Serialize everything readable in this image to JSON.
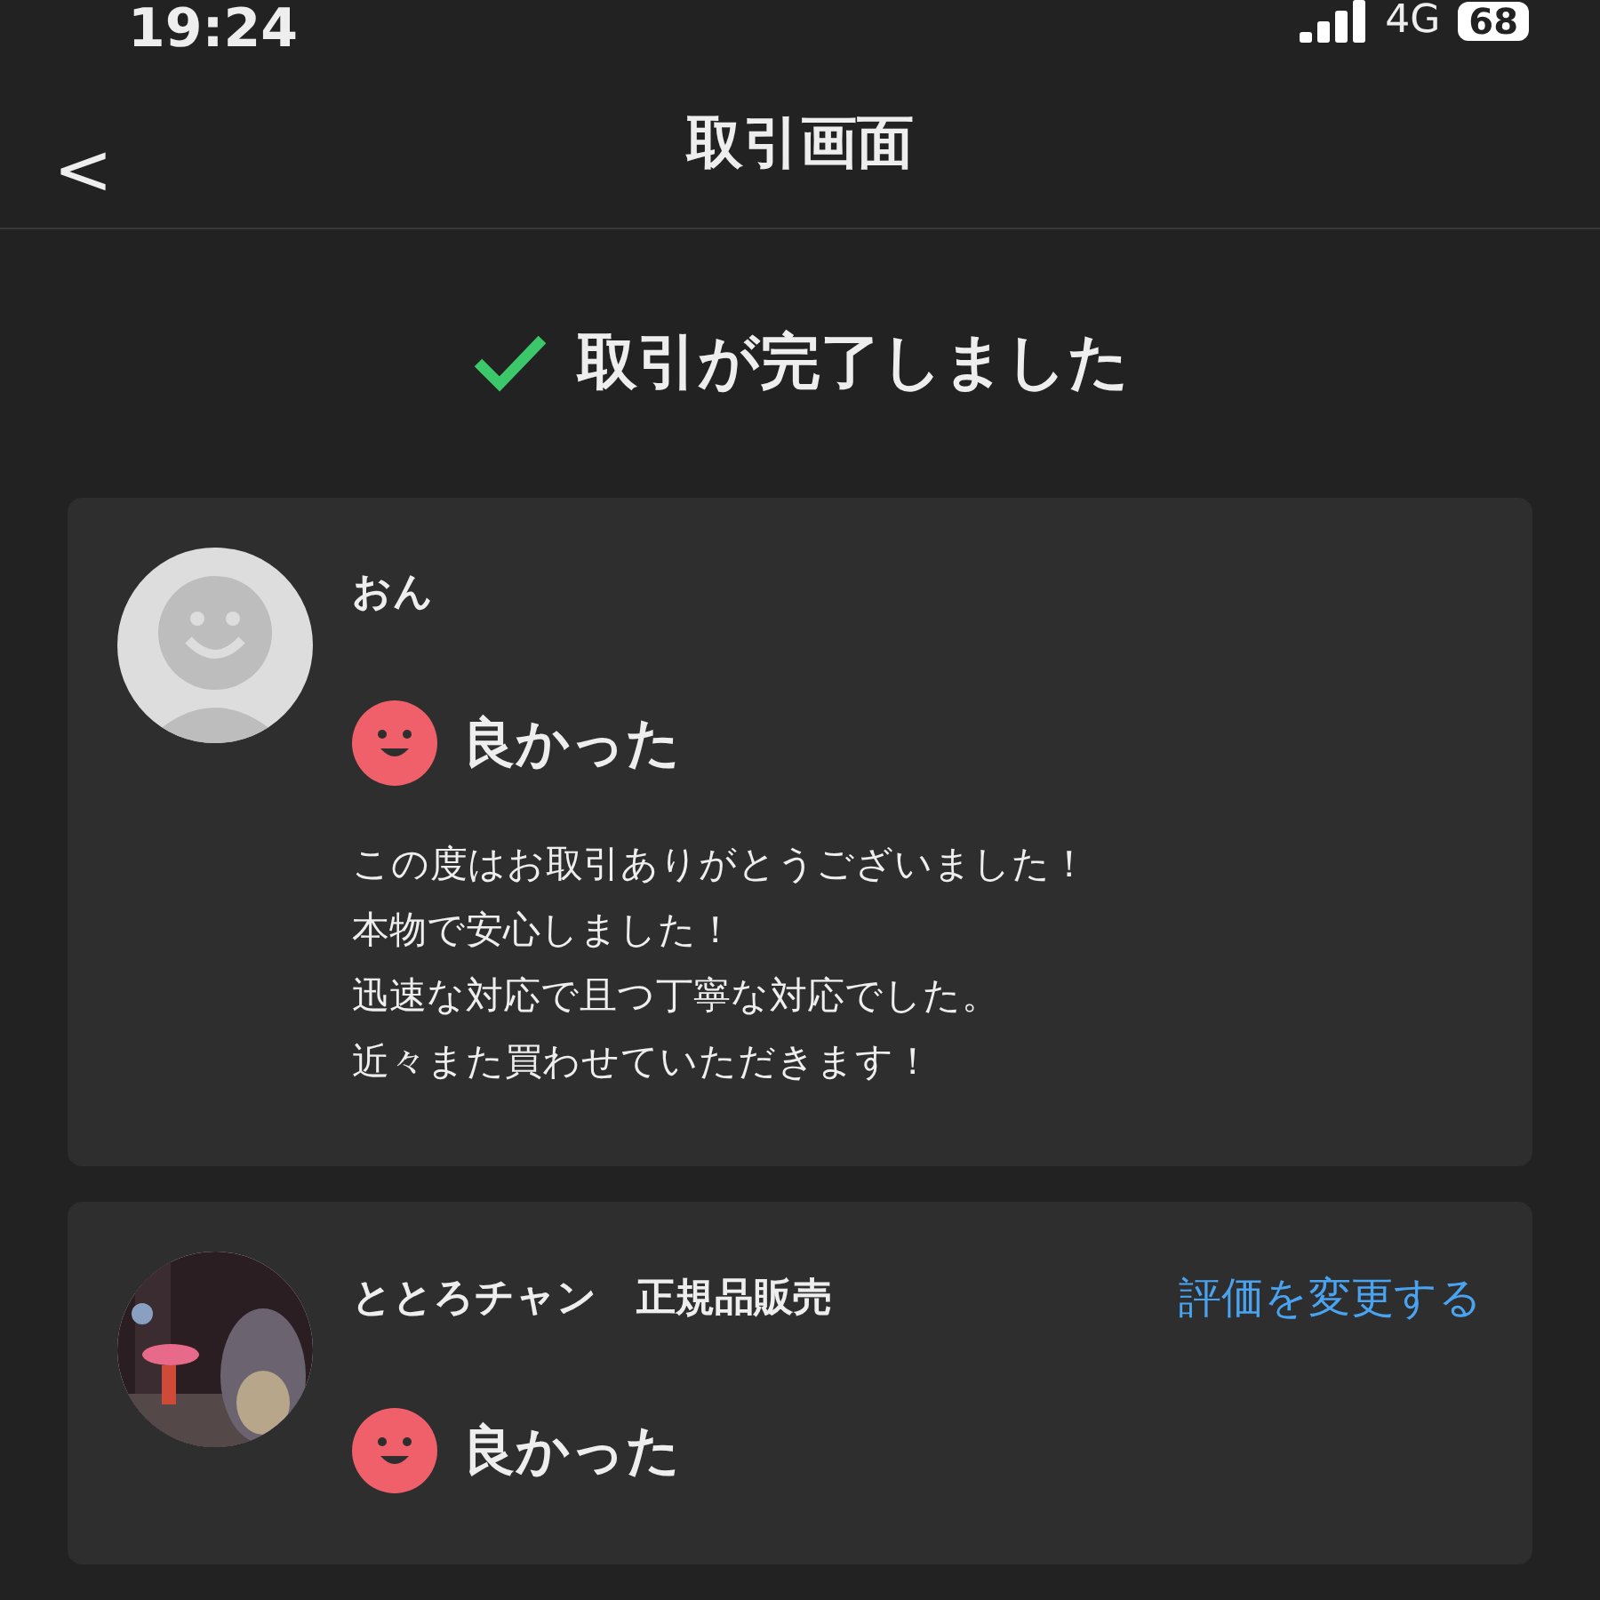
{
  "status_bar": {
    "time": "19:24",
    "network": "4G",
    "battery": "68"
  },
  "header": {
    "back": "<",
    "title": "取引画面"
  },
  "completion": {
    "message": "取引が完了しました"
  },
  "reviews": [
    {
      "name": "おん",
      "avatar": {
        "kind": "placeholder"
      },
      "rating": "良かった",
      "lines": [
        "この度はお取引ありがとうございました！",
        "本物で安心しました！",
        "迅速な対応で且つ丁寧な対応でした。",
        "近々また買わせていただきます！"
      ]
    },
    {
      "name": "ととろチャン　正規品販売",
      "rating": "良かった",
      "change_link": "評価を変更する"
    }
  ]
}
